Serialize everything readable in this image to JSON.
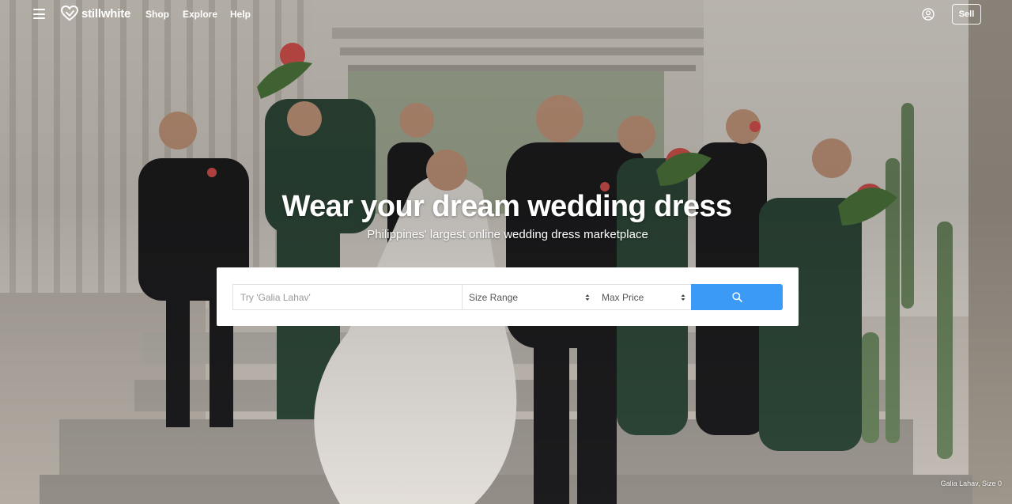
{
  "nav": {
    "logo_text": "stillwhite",
    "links": [
      "Shop",
      "Explore",
      "Help"
    ],
    "sell_label": "Sell"
  },
  "hero": {
    "headline": "Wear your dream wedding dress",
    "subheadline": "Philippines' largest online wedding dress marketplace",
    "caption": "Galia Lahav, Size 0"
  },
  "search": {
    "placeholder": "Try 'Galia Lahav'",
    "size_label": "Size Range",
    "price_label": "Max Price"
  },
  "colors": {
    "accent": "#3b9af5",
    "text_on_hero": "#ffffff"
  },
  "icons": [
    "menu-icon",
    "heart-logo-icon",
    "account-icon",
    "search-icon",
    "select-caret-icon"
  ]
}
